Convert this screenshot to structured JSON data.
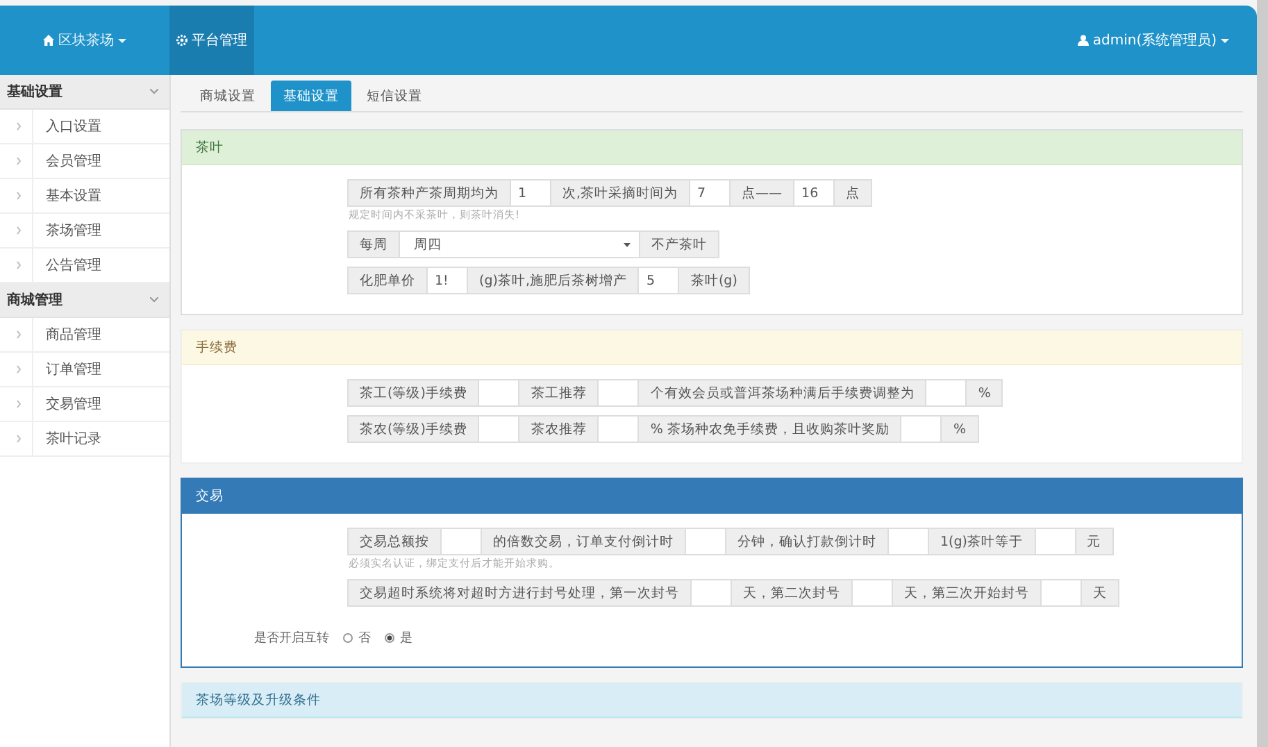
{
  "header": {
    "brand": "区块茶场",
    "nav_items": [
      {
        "label": "平台管理",
        "selected": true
      }
    ],
    "user": "admin(系统管理员)"
  },
  "sidebar": {
    "groups": [
      {
        "title": "基础设置",
        "expanded": true,
        "items": [
          "入口设置",
          "会员管理",
          "基本设置",
          "茶场管理",
          "公告管理"
        ]
      },
      {
        "title": "商城管理",
        "expanded": true,
        "items": [
          "商品管理",
          "订单管理",
          "交易管理",
          "茶叶记录"
        ]
      }
    ]
  },
  "tabs": [
    {
      "label": "商城设置",
      "selected": false
    },
    {
      "label": "基础设置",
      "selected": true
    },
    {
      "label": "短信设置",
      "selected": false
    }
  ],
  "panels": [
    {
      "title": "茶叶",
      "kind": "success",
      "rows": [
        {
          "kind": "group",
          "parts": [
            {
              "kind": "addon",
              "text": "所有茶种产茶周期均为"
            },
            {
              "kind": "input",
              "value": "1"
            },
            {
              "kind": "addon",
              "text": "次,茶叶采摘时间为"
            },
            {
              "kind": "input",
              "value": "7"
            },
            {
              "kind": "addon",
              "text": "点——"
            },
            {
              "kind": "input",
              "value": "16"
            },
            {
              "kind": "addon",
              "text": "点"
            }
          ]
        },
        {
          "kind": "help",
          "text": "规定时间内不采茶叶，则茶叶消失!"
        },
        {
          "kind": "group",
          "parts": [
            {
              "kind": "addon",
              "text": "每周"
            },
            {
              "kind": "select",
              "value": "周四"
            },
            {
              "kind": "addon",
              "text": "不产茶叶"
            }
          ]
        },
        {
          "kind": "group",
          "parts": [
            {
              "kind": "addon",
              "text": "化肥单价"
            },
            {
              "kind": "input",
              "value": "1!"
            },
            {
              "kind": "addon",
              "text": "(g)茶叶,施肥后茶树增产"
            },
            {
              "kind": "input",
              "value": "5"
            },
            {
              "kind": "addon",
              "text": "茶叶(g)"
            }
          ]
        }
      ]
    },
    {
      "title": "手续费",
      "kind": "warning",
      "rows": [
        {
          "kind": "group",
          "parts": [
            {
              "kind": "addon",
              "text": "茶工(等级)手续费"
            },
            {
              "kind": "input"
            },
            {
              "kind": "addon",
              "text": "茶工推荐"
            },
            {
              "kind": "input"
            },
            {
              "kind": "addon",
              "text": "个有效会员或普洱茶场种满后手续费调整为"
            },
            {
              "kind": "input"
            },
            {
              "kind": "addon",
              "text": "%"
            }
          ]
        },
        {
          "kind": "group",
          "parts": [
            {
              "kind": "addon",
              "text": "茶农(等级)手续费"
            },
            {
              "kind": "input"
            },
            {
              "kind": "addon",
              "text": "茶农推荐"
            },
            {
              "kind": "input"
            },
            {
              "kind": "addon",
              "text": "% 茶场种农免手续费，且收购茶叶奖励"
            },
            {
              "kind": "input"
            },
            {
              "kind": "addon",
              "text": "%"
            }
          ]
        }
      ]
    },
    {
      "title": "交易",
      "kind": "primary",
      "rows": [
        {
          "kind": "group",
          "parts": [
            {
              "kind": "addon",
              "text": "交易总额按"
            },
            {
              "kind": "input"
            },
            {
              "kind": "addon",
              "text": "的倍数交易，订单支付倒计时"
            },
            {
              "kind": "input"
            },
            {
              "kind": "addon",
              "text": "分钟，确认打款倒计时"
            },
            {
              "kind": "input"
            },
            {
              "kind": "addon",
              "text": "1(g)茶叶等于"
            },
            {
              "kind": "input"
            },
            {
              "kind": "addon",
              "text": "元"
            }
          ]
        },
        {
          "kind": "help",
          "text": "必须实名认证，绑定支付后才能开始求购。"
        },
        {
          "kind": "group",
          "parts": [
            {
              "kind": "addon",
              "text": "交易超时系统将对超时方进行封号处理，第一次封号"
            },
            {
              "kind": "input"
            },
            {
              "kind": "addon",
              "text": "天，第二次封号"
            },
            {
              "kind": "input"
            },
            {
              "kind": "addon",
              "text": "天，第三次开始封号"
            },
            {
              "kind": "input"
            },
            {
              "kind": "addon",
              "text": "天"
            }
          ]
        },
        {
          "kind": "radio",
          "label": "是否开启互转",
          "options": [
            {
              "label": "否",
              "selected": false
            },
            {
              "label": "是",
              "selected": true
            }
          ]
        }
      ]
    },
    {
      "title": "茶场等级及升级条件",
      "kind": "info"
    }
  ]
}
